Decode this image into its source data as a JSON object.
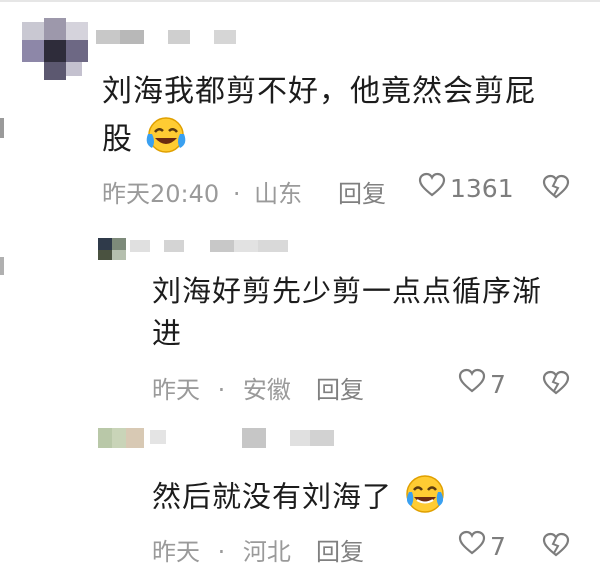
{
  "comments": [
    {
      "text_line1": "刘海我都剪不好，他竟然会剪屁",
      "text_line2": "股",
      "emoji": "laugh-cry-emoji",
      "time": "昨天20:40",
      "location": "山东",
      "reply_label": "回复",
      "like_count": "1361"
    }
  ],
  "replies": [
    {
      "text_line1": "刘海好剪先少剪一点点循序渐",
      "text_line2": "进",
      "time": "昨天",
      "location": "安徽",
      "reply_label": "回复",
      "like_count": "7"
    },
    {
      "text": "然后就没有刘海了",
      "emoji": "tears-of-joy-emoji",
      "time": "昨天",
      "location": "河北",
      "reply_label": "回复",
      "like_count": "7"
    }
  ],
  "separator": "·",
  "colors": {
    "text": "#1c1c1c",
    "meta": "#9a9a9a",
    "background": "#ffffff"
  }
}
